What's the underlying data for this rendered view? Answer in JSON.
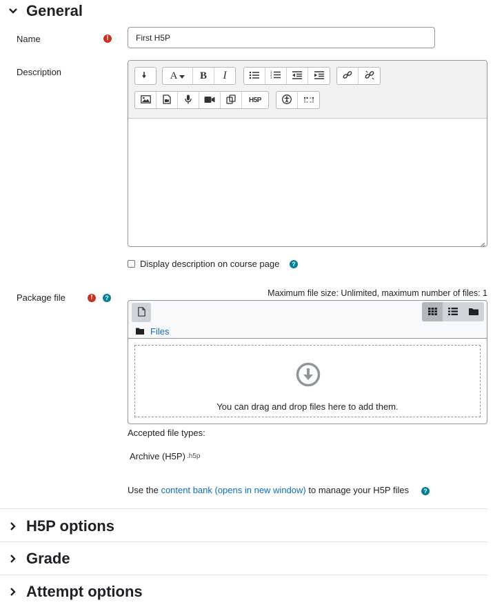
{
  "sections": {
    "general": "General",
    "h5p_options": "H5P options",
    "grade": "Grade",
    "attempt_options": "Attempt options"
  },
  "fields": {
    "name_label": "Name",
    "name_value": "First H5P",
    "description_label": "Description",
    "display_description": "Display description on course page",
    "package_label": "Package file"
  },
  "editor": {
    "font_label": "A",
    "bold": "B",
    "italic": "I",
    "h5p_label": "H5P"
  },
  "filepicker": {
    "limits": "Maximum file size: Unlimited, maximum number of files: 1",
    "breadcrumb": "Files",
    "drop_text": "You can drag and drop files here to add them."
  },
  "accepted": {
    "heading": "Accepted file types:",
    "type_name": "Archive (H5P)",
    "type_ext": ".h5p"
  },
  "footer_note": {
    "before": "Use the",
    "link": "content bank (opens in new window)",
    "after": "to manage your H5P files"
  },
  "colors": {
    "required": "#ca3120",
    "help": "#008196",
    "link": "#0f6cbf"
  }
}
